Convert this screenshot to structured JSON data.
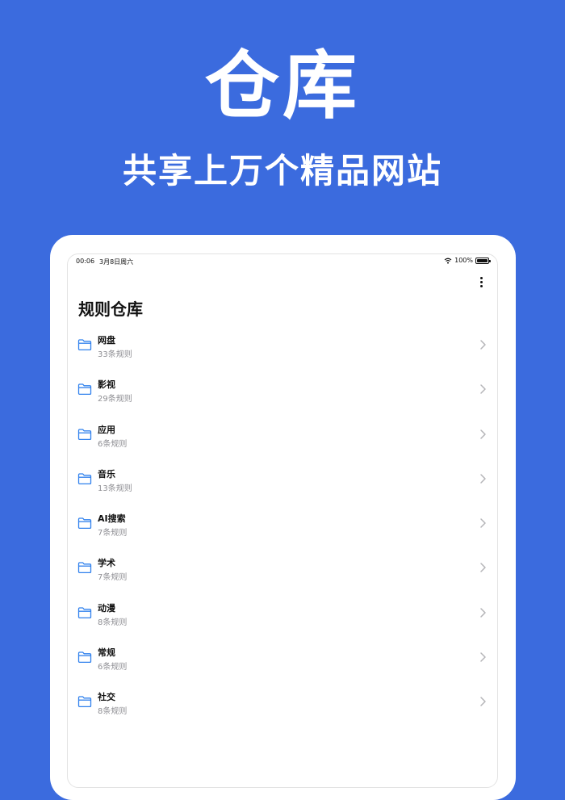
{
  "hero": {
    "title": "仓库",
    "subtitle": "共享上万个精品网站"
  },
  "statusbar": {
    "time": "00:06",
    "date": "3月8日周六",
    "battery": "100%"
  },
  "page": {
    "title": "规则仓库"
  },
  "categories": [
    {
      "name": "网盘",
      "count": "33条规则"
    },
    {
      "name": "影视",
      "count": "29条规则"
    },
    {
      "name": "应用",
      "count": "6条规则"
    },
    {
      "name": "音乐",
      "count": "13条规则"
    },
    {
      "name": "AI搜索",
      "count": "7条规则"
    },
    {
      "name": "学术",
      "count": "7条规则"
    },
    {
      "name": "动漫",
      "count": "8条规则"
    },
    {
      "name": "常规",
      "count": "6条规则"
    },
    {
      "name": "社交",
      "count": "8条规则"
    }
  ],
  "colors": {
    "background": "#3b6bde",
    "folder_icon": "#2f80ed",
    "chevron": "#b5b5b8"
  }
}
